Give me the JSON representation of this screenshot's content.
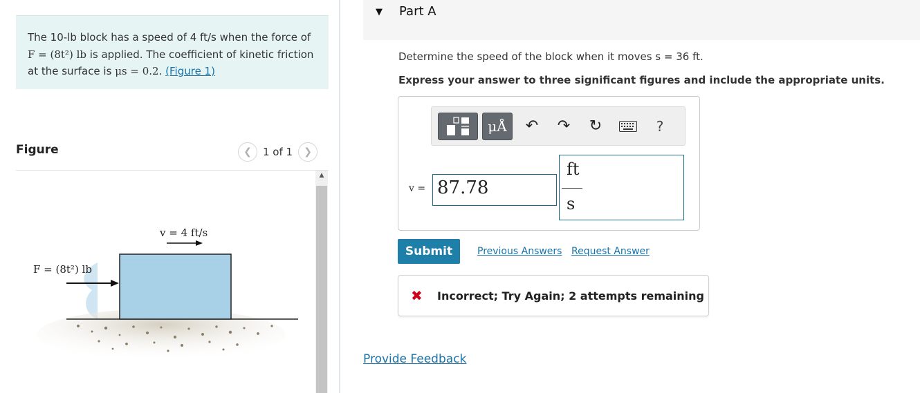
{
  "problem": {
    "text_1": "The 10-lb block has a speed of 4 ft/s when the force of ",
    "force_expr": "F = (8t²) lb",
    "text_2": " is applied. The coefficient of kinetic friction at the surface is ",
    "mu_expr": "μs = 0.2",
    "text_3": ". ",
    "figure_link": "(Figure 1)"
  },
  "figure": {
    "title": "Figure",
    "pager": "1 of 1",
    "velocity_label": "v = 4 ft/s",
    "force_label": "F = (8t²) lb"
  },
  "part": {
    "label": "Part A",
    "question": "Determine the speed of the block when it moves s = 36 ft.",
    "instruction": "Express your answer to three significant figures and include the appropriate units."
  },
  "toolbar": {
    "mu_label": "μÅ",
    "help_label": "?"
  },
  "answer": {
    "variable": "v =",
    "value": "87.78",
    "unit_numerator": "ft",
    "unit_denominator": "s"
  },
  "actions": {
    "submit": "Submit",
    "previous_answers": "Previous Answers",
    "request_answer": "Request Answer"
  },
  "feedback": {
    "message": "Incorrect; Try Again; 2 attempts remaining"
  },
  "footer": {
    "provide_feedback": "Provide Feedback"
  },
  "colors": {
    "accent": "#1e7fa8",
    "problem_bg": "#e6f4f4",
    "error": "#d0021b",
    "block_fill": "#a8d0e6"
  }
}
